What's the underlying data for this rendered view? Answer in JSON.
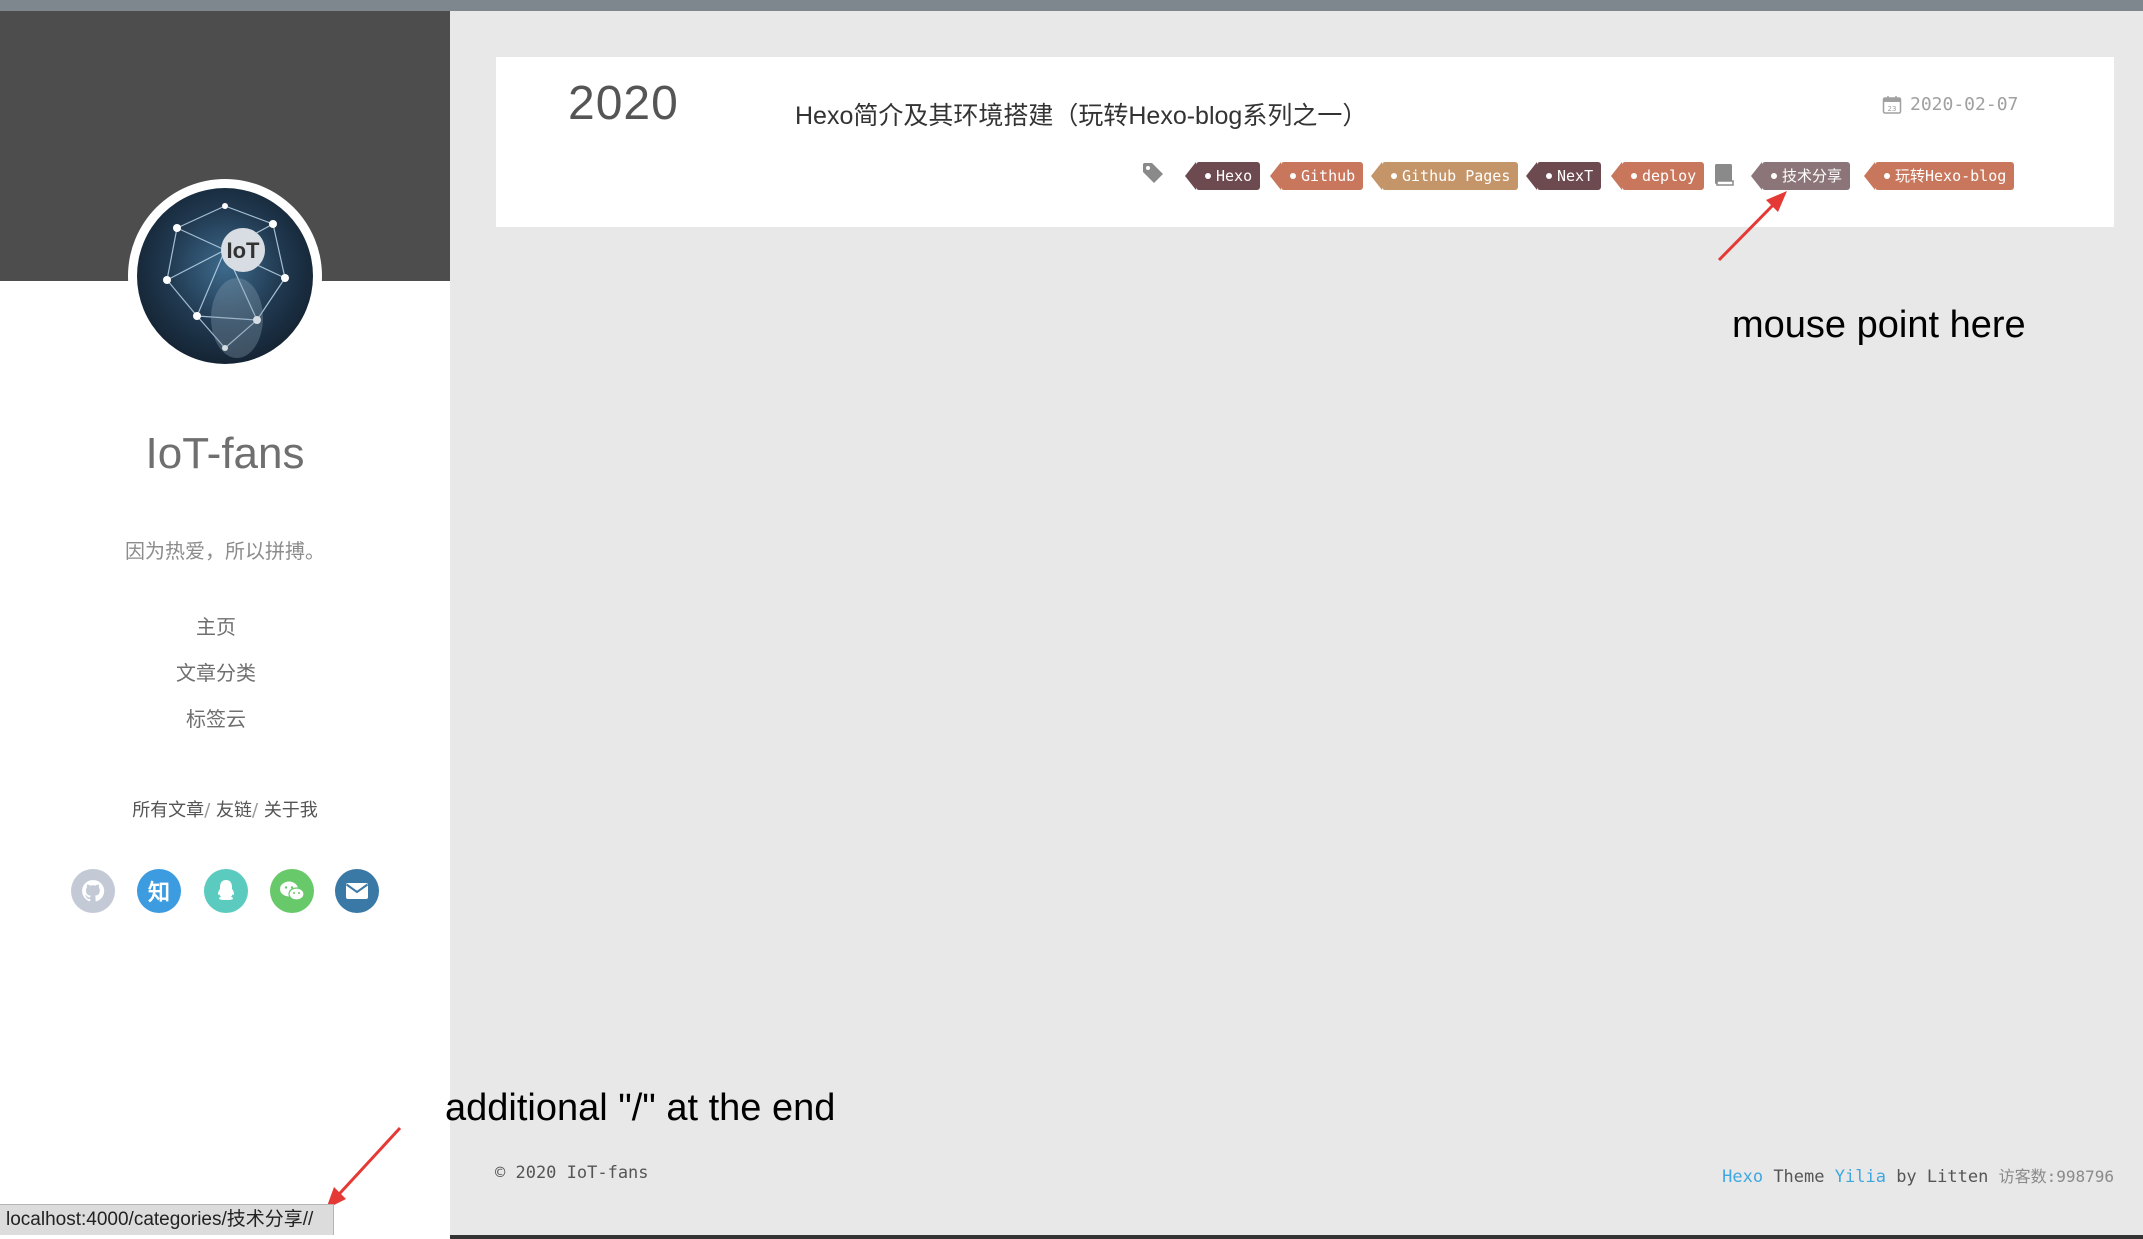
{
  "sidebar": {
    "avatar_text": "IoT",
    "site_title": "IoT-fans",
    "subtitle": "因为热爱，所以拼搏。",
    "nav": [
      {
        "label": "主页"
      },
      {
        "label": "文章分类"
      },
      {
        "label": "标签云"
      }
    ],
    "links": [
      {
        "label": "所有文章"
      },
      {
        "label": "友链"
      },
      {
        "label": "关于我"
      }
    ],
    "link_separator": "/",
    "social": [
      {
        "icon": "github-icon",
        "color": "#c3cad6"
      },
      {
        "icon": "zhihu-icon",
        "glyph": "知",
        "color": "#3d9be0"
      },
      {
        "icon": "qq-icon",
        "color": "#5ccbbf"
      },
      {
        "icon": "wechat-icon",
        "color": "#68c96a"
      },
      {
        "icon": "mail-icon",
        "color": "#3a78a6"
      }
    ]
  },
  "post": {
    "year": "2020",
    "title": "Hexo简介及其环境搭建（玩转Hexo-blog系列之一）",
    "date": "2020-02-07",
    "date_icon_day": "23",
    "tags": [
      {
        "label": "Hexo",
        "color": "#6d4a50"
      },
      {
        "label": "Github",
        "color": "#c9775c"
      },
      {
        "label": "Github Pages",
        "color": "#c49568"
      },
      {
        "label": "NexT",
        "color": "#6d4a50"
      },
      {
        "label": "deploy",
        "color": "#c9775c"
      }
    ],
    "categories": [
      {
        "label": "技术分享",
        "color": "#8b7578"
      },
      {
        "label": "玩转Hexo-blog",
        "color": "#c9775c"
      }
    ]
  },
  "annotations": {
    "mouse_note": "mouse point here",
    "slash_note": "additional \"/\" at the end"
  },
  "footer": {
    "copyright": "© 2020 IoT-fans",
    "hexo": "Hexo",
    "theme": "Theme",
    "yilia": "Yilia",
    "by": "by Litten",
    "visits": "访客数:998796"
  },
  "status_url": "localhost:4000/categories/技术分享//"
}
